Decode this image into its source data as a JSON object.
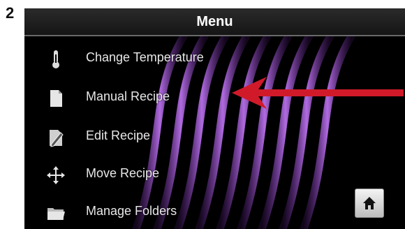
{
  "step": "2",
  "screen": {
    "title": "Menu",
    "items": [
      {
        "label": "Change Temperature",
        "icon": "thermometer-icon"
      },
      {
        "label": "Manual Recipe",
        "icon": "document-icon"
      },
      {
        "label": "Edit Recipe",
        "icon": "edit-icon"
      },
      {
        "label": "Move Recipe",
        "icon": "move-arrows-icon"
      },
      {
        "label": "Manage Folders",
        "icon": "folder-icon"
      }
    ],
    "home_icon": "home-icon"
  },
  "annotation": {
    "arrow_color": "#d01a2a",
    "accent_color": "#8a3bbf"
  }
}
